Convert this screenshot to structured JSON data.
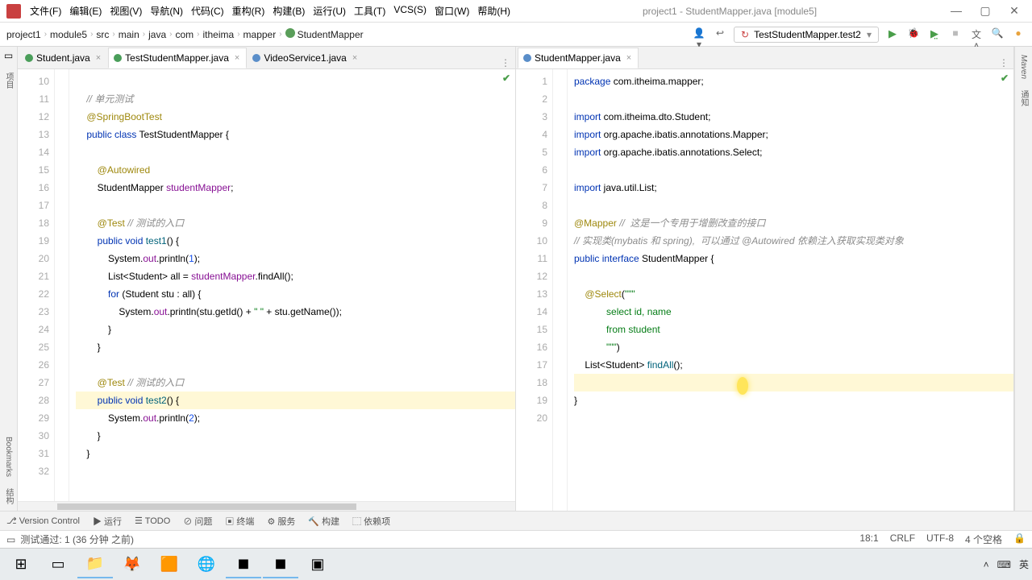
{
  "window": {
    "title": "project1 - StudentMapper.java [module5]"
  },
  "menus": [
    "文件(F)",
    "编辑(E)",
    "视图(V)",
    "导航(N)",
    "代码(C)",
    "重构(R)",
    "构建(B)",
    "运行(U)",
    "工具(T)",
    "VCS(S)",
    "窗口(W)",
    "帮助(H)"
  ],
  "breadcrumb": [
    "project1",
    "module5",
    "src",
    "main",
    "java",
    "com",
    "itheima",
    "mapper",
    "StudentMapper"
  ],
  "runconfig": "TestStudentMapper.test2",
  "leftPane": {
    "tabs": [
      {
        "label": "Student.java",
        "kind": "c"
      },
      {
        "label": "TestStudentMapper.java",
        "kind": "c",
        "active": true
      },
      {
        "label": "VideoService1.java",
        "kind": "i"
      }
    ],
    "startLine": 10,
    "lines": [
      "",
      "    <span class='cmt'>// 单元测试</span>",
      "    <span class='ann'>@SpringBootTest</span>",
      "    <span class='kw'>public class</span> TestStudentMapper {",
      "",
      "        <span class='ann'>@Autowired</span>",
      "        StudentMapper <span class='fld'>studentMapper</span>;",
      "",
      "        <span class='ann'>@Test</span> <span class='cmt'>// 测试的入口</span>",
      "        <span class='kw'>public void</span> <span class='mth'>test1</span>() {",
      "            System.<span class='fld'>out</span>.println(<span class='num'>1</span>);",
      "            List&lt;Student&gt; all = <span class='fld'>studentMapper</span>.findAll();",
      "            <span class='kw'>for</span> (Student stu : all) {",
      "                System.<span class='fld'>out</span>.println(stu.getId() + <span class='str'>\" \"</span> + stu.getName());",
      "            }",
      "        }",
      "",
      "        <span class='ann'>@Test</span> <span class='cmt'>// 测试的入口</span>",
      "        <span class='kw'>public void</span> <span class='mth'>test2</span>() {",
      "            System.<span class='fld'>out</span>.println(<span class='num'>2</span>);",
      "        }",
      "    }",
      ""
    ]
  },
  "rightPane": {
    "tabs": [
      {
        "label": "StudentMapper.java",
        "kind": "i",
        "active": true
      }
    ],
    "startLine": 1,
    "lines": [
      "<span class='kw'>package</span> com.itheima.mapper;",
      "",
      "<span class='kw'>import</span> com.itheima.dto.Student;",
      "<span class='kw'>import</span> org.apache.ibatis.annotations.<span class='typ'>Mapper</span>;",
      "<span class='kw'>import</span> org.apache.ibatis.annotations.<span class='typ'>Select</span>;",
      "",
      "<span class='kw'>import</span> java.util.List;",
      "",
      "<span class='ann'>@Mapper</span> <span class='cmt'>//  这是一个专用于增删改查的接口</span>",
      "<span class='cmt'>// 实现类(mybatis 和 spring),  可以通过 @Autowired 依赖注入获取实现类对象</span>",
      "<span class='kw'>public interface</span> StudentMapper {",
      "",
      "    <span class='ann'>@Select</span>(<span class='str'>\"\"\"</span>",
      "            <span class='str'>select id, name</span>",
      "            <span class='str'>from student</span>",
      "            <span class='str'>\"\"\"</span>)",
      "    List&lt;Student&gt; <span class='mth'>findAll</span>();",
      "",
      "}",
      ""
    ],
    "caretLine": 18
  },
  "toolwindows": [
    "Version Control",
    "运行",
    "TODO",
    "问题",
    "终端",
    "服务",
    "构建",
    "依赖项"
  ],
  "status": {
    "msg": "测试通过: 1 (36 分钟 之前)",
    "pos": "18:1",
    "enc": "CRLF",
    "charset": "UTF-8",
    "indent": "4 个空格"
  },
  "sidebars": {
    "left": [
      "项目",
      "Bookmarks",
      "结构"
    ],
    "right": [
      "Maven",
      "通知"
    ]
  },
  "tray": {
    "ime": "英"
  }
}
